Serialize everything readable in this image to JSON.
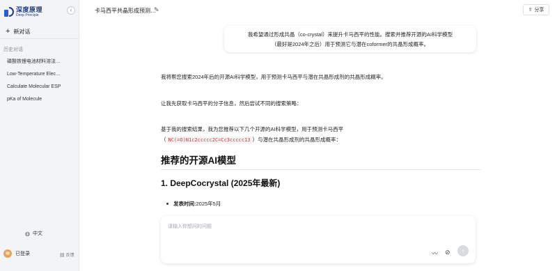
{
  "sidebar": {
    "logo_cn": "深度原理",
    "logo_en": "Deep Principle",
    "collapse_icon": "chevron-left-icon",
    "new_chat_label": "新对话",
    "history_title": "历史对话",
    "history_items": [
      {
        "label": "磷酸铁锂电池材料溶法…"
      },
      {
        "label": "Low-Temperature Elec…"
      },
      {
        "label": "Calculate Molecular ESP"
      },
      {
        "label": "pKa of Molecule"
      }
    ],
    "language": "中文",
    "user_status": "已登录",
    "feedback_label": "反馈"
  },
  "header": {
    "title": "卡马西平共晶形成预测…",
    "share_label": "分享"
  },
  "user_message": {
    "line1": "我希望通过形成共晶（co-crystal）来提升卡马西平的性能。搜索并推荐开源的AI科学模型",
    "line2": "（最好是2024年之后）用于预测它与潜在coformer的共晶形成概率。"
  },
  "assistant": {
    "p1": "我将帮您搜索2024年后的开源AI科学模型，用于预测卡马西平与潜在共晶形成剂的共晶形成概率。",
    "p2": "让我先获取卡马西平的分子信息，然后尝试不同的搜索策略：",
    "p3": "基于我的搜索结果，我为您推荐以下几个开源的AI科学模型，用于预测卡马西平",
    "p4_open": "（",
    "smiles": "NC(=O)N1c2ccccc2C=Cc3ccccc13",
    "p4_close": "）与潜在共晶形成剂的共晶形成概率：",
    "h2": "推荐的开源AI模型",
    "h3": "1. DeepCocrystal (2025年最新)",
    "bullet_label": "发表时间:",
    "bullet_value": " 2025年5月"
  },
  "input": {
    "placeholder": "请输入你想问的问题"
  },
  "colors": {
    "brand": "#1e3a8a",
    "sidebar_bg": "#f3f4f6",
    "code_text": "#d03535"
  }
}
